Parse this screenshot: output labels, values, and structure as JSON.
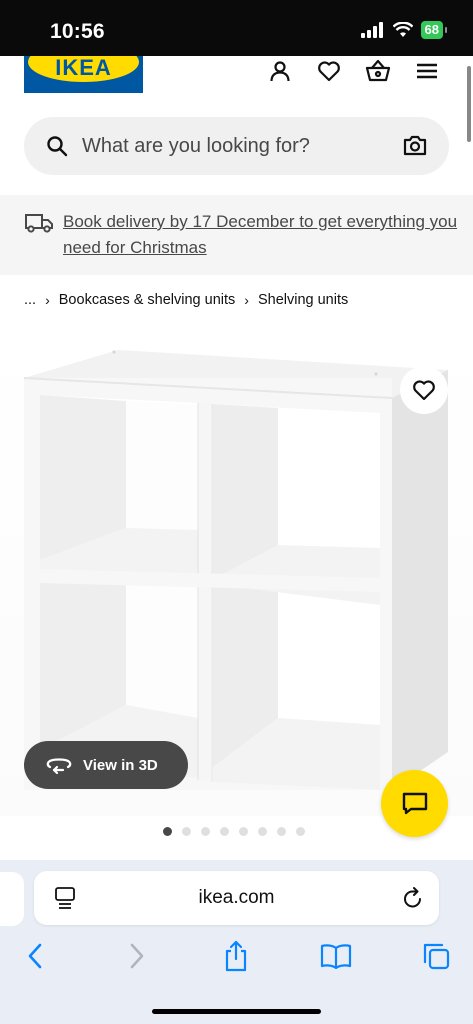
{
  "status_bar": {
    "time": "10:56",
    "battery": "68"
  },
  "header": {
    "logo_text": "IKEA",
    "icons": [
      "profile-icon",
      "heart-icon",
      "basket-icon",
      "menu-icon"
    ]
  },
  "search": {
    "placeholder": "What are you looking for?"
  },
  "banner": {
    "text": "Book delivery by 17 December to get everything you need for Christmas"
  },
  "breadcrumb": {
    "ellipsis": "...",
    "items": [
      "Bookcases & shelving units",
      "Shelving units"
    ]
  },
  "product": {
    "view3d_label": "View in 3D",
    "carousel_count": 8,
    "carousel_active": 0
  },
  "browser": {
    "url": "ikea.com"
  },
  "colors": {
    "ikea_blue": "#0058a3",
    "ikea_yellow": "#ffdb00",
    "safari_blue": "#0a84ff"
  }
}
